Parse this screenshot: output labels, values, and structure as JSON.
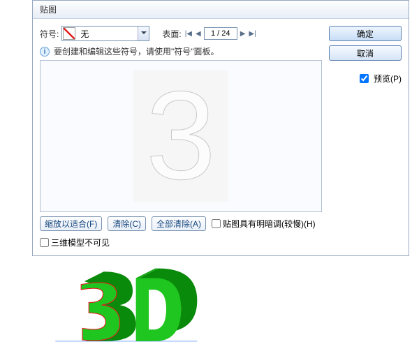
{
  "dialog": {
    "title": "贴图",
    "symbol_label": "符号:",
    "symbol_value": "无",
    "face_label": "表面:",
    "page": "1 / 24",
    "info_text": "要创建和编辑这些符号，请使用\"符号\"面板。",
    "glyph": "3",
    "buttons": {
      "fit": "缩放以适合(F)",
      "clear": "清除(C)",
      "clear_all": "全部清除(A)"
    },
    "checks": {
      "shade": "贴图具有明暗调(较慢)(H)",
      "hide3d": "三维模型不可见"
    }
  },
  "side": {
    "ok": "确定",
    "cancel": "取消",
    "preview": "预览(P)"
  },
  "illustration": {
    "text": "3D"
  }
}
